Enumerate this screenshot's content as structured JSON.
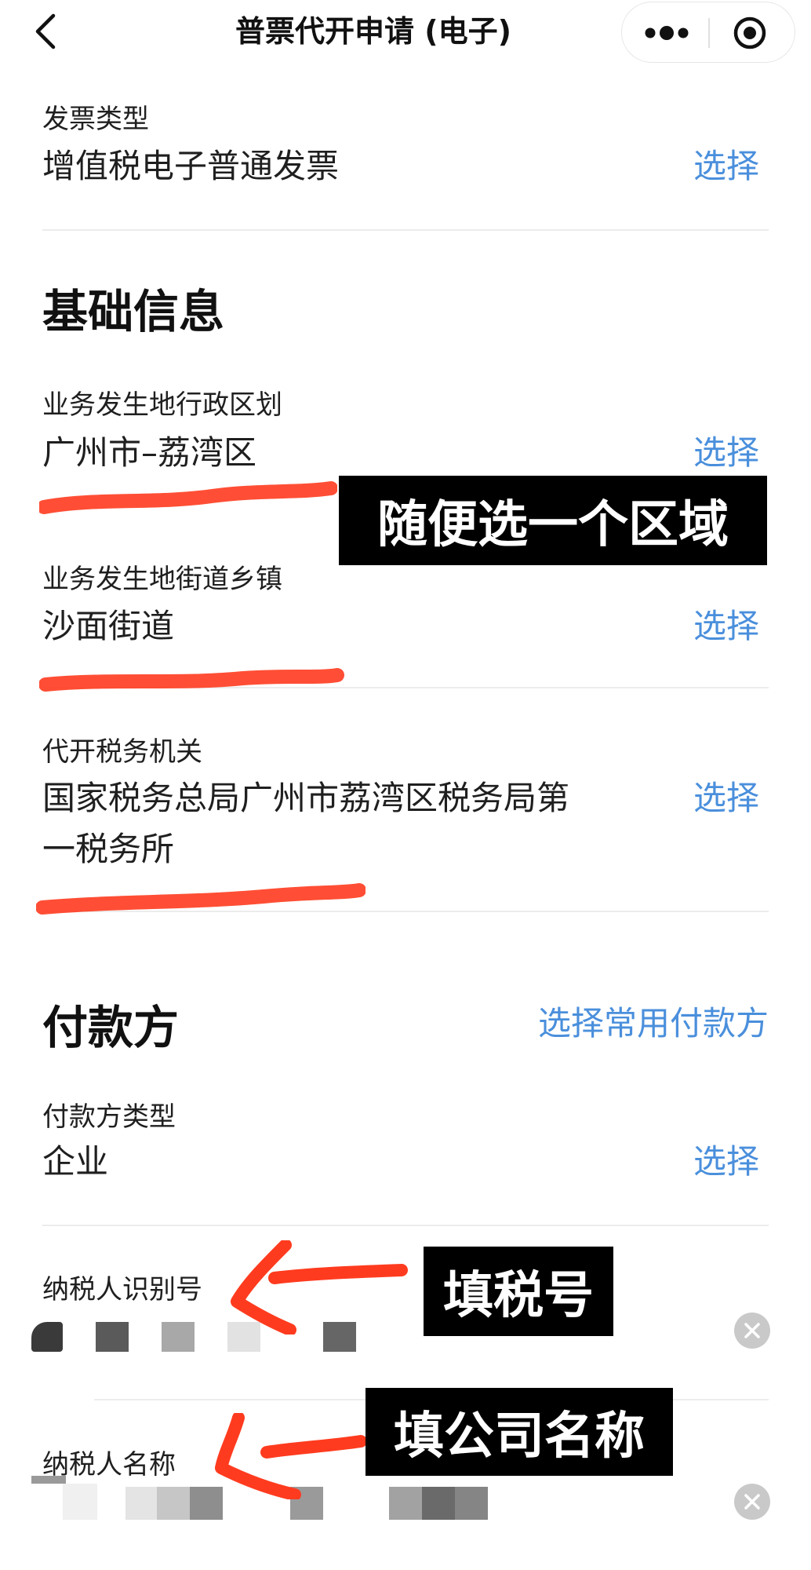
{
  "nav": {
    "title": "普票代开申请 (电子)",
    "back_icon": "chevron-left-icon",
    "more_icon": "more-dots-icon",
    "close_icon": "target-close-icon"
  },
  "invoice_type": {
    "label": "发票类型",
    "value": "增值税电子普通发票",
    "action": "选择"
  },
  "basic_info": {
    "title": "基础信息",
    "region": {
      "label": "业务发生地行政区划",
      "value": "广州市–荔湾区",
      "action": "选择"
    },
    "street": {
      "label": "业务发生地街道乡镇",
      "value": "沙面街道",
      "action": "选择"
    },
    "tax_office": {
      "label": "代开税务机关",
      "value_line1": "国家税务总局广州市荔湾区税务局第",
      "value_line2": "一税务所",
      "action": "选择"
    }
  },
  "payer": {
    "title": "付款方",
    "common_link": "选择常用付款方",
    "payer_type": {
      "label": "付款方类型",
      "value": "企业",
      "action": "选择"
    },
    "taxpayer_id": {
      "label": "纳税人识别号"
    },
    "taxpayer_name": {
      "label": "纳税人名称"
    }
  },
  "annotations": {
    "note_region": "随便选一个区域",
    "note_tax_id": "填税号",
    "note_company": "填公司名称"
  },
  "colors": {
    "link": "#4a8fdc",
    "scribble": "#ff3b1f",
    "note_bg": "#000000",
    "clear_btn": "#c9c9c9"
  }
}
